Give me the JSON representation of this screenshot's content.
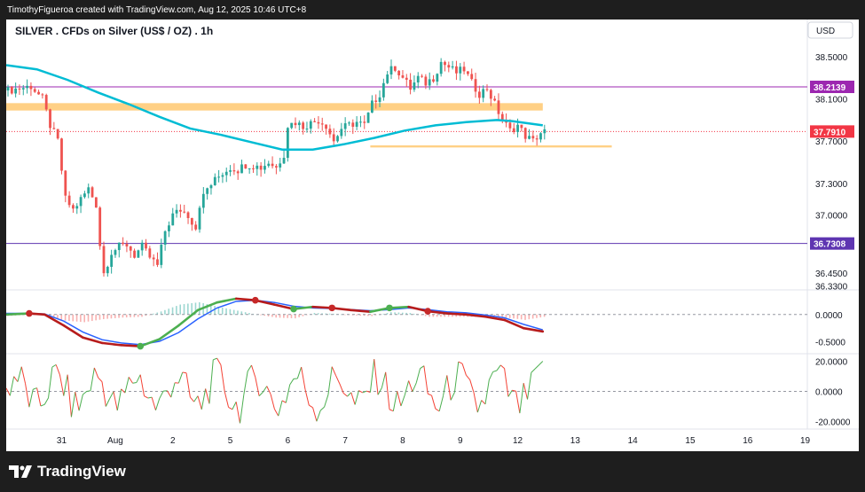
{
  "header": {
    "attribution": "TimothyFigueroa created with TradingView.com, Aug 12, 2025 10:46 UTC+8"
  },
  "footer": {
    "brand": "TradingView"
  },
  "chart_data": {
    "type": "candlestick",
    "title": "SILVER . CFDs on Silver (US$ / OZ) . 1h",
    "currency_label": "USD",
    "ylim": [
      36.3,
      38.6
    ],
    "price_ticks": [
      "38.5000",
      "38.1000",
      "37.7000",
      "37.3000",
      "37.0000",
      "36.4500",
      "36.3300"
    ],
    "horizontal_lines": [
      {
        "label": "38.2139",
        "value": 38.2139,
        "color": "#9c27b0"
      },
      {
        "label": "36.7308",
        "value": 36.7308,
        "color": "#5e35b1"
      }
    ],
    "last_price": {
      "label": "37.7910",
      "value": 37.791,
      "color": "#f23645"
    },
    "zones": [
      {
        "from_index": 0,
        "to_index": 140,
        "low": 37.99,
        "high": 38.06,
        "color": "#ffc870"
      },
      {
        "from_index": 95,
        "to_index": 158,
        "low": 37.64,
        "high": 37.66,
        "color": "#ffc870"
      }
    ],
    "x_ticks": [
      {
        "label": "31",
        "index": 14
      },
      {
        "label": "Aug",
        "index": 28
      },
      {
        "label": "2",
        "index": 43
      },
      {
        "label": "5",
        "index": 58
      },
      {
        "label": "6",
        "index": 73
      },
      {
        "label": "7",
        "index": 88
      },
      {
        "label": "8",
        "index": 103
      },
      {
        "label": "9",
        "index": 118
      },
      {
        "label": "12",
        "index": 133
      },
      {
        "label": "13",
        "index": 148
      },
      {
        "label": "14",
        "index": 163
      },
      {
        "label": "15",
        "index": 178
      },
      {
        "label": "16",
        "index": 193
      },
      {
        "label": "19",
        "index": 208
      }
    ],
    "close_path": [
      [
        0,
        38.18
      ],
      [
        3,
        38.2
      ],
      [
        6,
        38.22
      ],
      [
        9,
        38.1
      ],
      [
        11,
        37.85
      ],
      [
        13,
        37.7
      ],
      [
        15,
        37.15
      ],
      [
        17,
        37.05
      ],
      [
        19,
        37.15
      ],
      [
        21,
        37.25
      ],
      [
        23,
        37.1
      ],
      [
        24,
        36.72
      ],
      [
        25,
        36.45
      ],
      [
        27,
        36.65
      ],
      [
        29,
        36.7
      ],
      [
        31,
        36.72
      ],
      [
        33,
        36.62
      ],
      [
        35,
        36.7
      ],
      [
        37,
        36.6
      ],
      [
        39,
        36.52
      ],
      [
        41,
        36.85
      ],
      [
        43,
        37.0
      ],
      [
        45,
        37.05
      ],
      [
        47,
        37.0
      ],
      [
        49,
        36.88
      ],
      [
        50,
        37.1
      ],
      [
        52,
        37.25
      ],
      [
        54,
        37.33
      ],
      [
        56,
        37.4
      ],
      [
        58,
        37.45
      ],
      [
        60,
        37.43
      ],
      [
        62,
        37.48
      ],
      [
        64,
        37.47
      ],
      [
        66,
        37.45
      ],
      [
        68,
        37.5
      ],
      [
        70,
        37.45
      ],
      [
        72,
        37.58
      ],
      [
        73,
        37.85
      ],
      [
        75,
        37.88
      ],
      [
        77,
        37.84
      ],
      [
        79,
        37.87
      ],
      [
        81,
        37.9
      ],
      [
        83,
        37.85
      ],
      [
        85,
        37.7
      ],
      [
        87,
        37.82
      ],
      [
        89,
        37.85
      ],
      [
        91,
        37.88
      ],
      [
        93,
        37.85
      ],
      [
        95,
        38.05
      ],
      [
        97,
        38.15
      ],
      [
        99,
        38.35
      ],
      [
        101,
        38.4
      ],
      [
        103,
        38.3
      ],
      [
        105,
        38.2
      ],
      [
        107,
        38.3
      ],
      [
        109,
        38.25
      ],
      [
        111,
        38.3
      ],
      [
        113,
        38.45
      ],
      [
        115,
        38.4
      ],
      [
        117,
        38.35
      ],
      [
        119,
        38.38
      ],
      [
        121,
        38.25
      ],
      [
        123,
        38.15
      ],
      [
        125,
        38.2
      ],
      [
        127,
        38.05
      ],
      [
        129,
        37.9
      ],
      [
        131,
        37.8
      ],
      [
        133,
        37.85
      ],
      [
        135,
        37.75
      ],
      [
        137,
        37.7
      ],
      [
        139,
        37.78
      ],
      [
        140,
        37.79
      ]
    ],
    "ma_path": [
      [
        0,
        38.42
      ],
      [
        8,
        38.38
      ],
      [
        16,
        38.28
      ],
      [
        24,
        38.16
      ],
      [
        32,
        38.05
      ],
      [
        40,
        37.93
      ],
      [
        48,
        37.82
      ],
      [
        56,
        37.76
      ],
      [
        64,
        37.69
      ],
      [
        72,
        37.62
      ],
      [
        80,
        37.62
      ],
      [
        88,
        37.67
      ],
      [
        96,
        37.73
      ],
      [
        104,
        37.8
      ],
      [
        112,
        37.85
      ],
      [
        120,
        37.88
      ],
      [
        128,
        37.9
      ],
      [
        132,
        37.89
      ],
      [
        136,
        37.87
      ],
      [
        140,
        37.85
      ]
    ],
    "macd_panel": {
      "ylim": [
        -0.7,
        0.45
      ],
      "ticks": [
        "0.0000",
        "-0.5000"
      ],
      "zero": 0,
      "macd": [
        [
          0,
          0.0
        ],
        [
          6,
          0.02
        ],
        [
          10,
          0.0
        ],
        [
          15,
          -0.2
        ],
        [
          20,
          -0.42
        ],
        [
          25,
          -0.52
        ],
        [
          30,
          -0.56
        ],
        [
          35,
          -0.58
        ],
        [
          40,
          -0.45
        ],
        [
          45,
          -0.2
        ],
        [
          50,
          0.08
        ],
        [
          55,
          0.22
        ],
        [
          60,
          0.29
        ],
        [
          65,
          0.26
        ],
        [
          70,
          0.18
        ],
        [
          75,
          0.1
        ],
        [
          80,
          0.14
        ],
        [
          85,
          0.12
        ],
        [
          90,
          0.08
        ],
        [
          95,
          0.05
        ],
        [
          100,
          0.12
        ],
        [
          105,
          0.14
        ],
        [
          110,
          0.06
        ],
        [
          115,
          0.02
        ],
        [
          120,
          0.0
        ],
        [
          125,
          -0.04
        ],
        [
          130,
          -0.1
        ],
        [
          135,
          -0.25
        ],
        [
          140,
          -0.31
        ]
      ],
      "signal": [
        [
          0,
          0.02
        ],
        [
          6,
          0.02
        ],
        [
          10,
          0.01
        ],
        [
          15,
          -0.12
        ],
        [
          20,
          -0.32
        ],
        [
          25,
          -0.46
        ],
        [
          30,
          -0.52
        ],
        [
          35,
          -0.55
        ],
        [
          40,
          -0.49
        ],
        [
          45,
          -0.33
        ],
        [
          50,
          -0.08
        ],
        [
          55,
          0.12
        ],
        [
          60,
          0.24
        ],
        [
          65,
          0.26
        ],
        [
          70,
          0.22
        ],
        [
          75,
          0.15
        ],
        [
          80,
          0.12
        ],
        [
          85,
          0.11
        ],
        [
          90,
          0.09
        ],
        [
          95,
          0.07
        ],
        [
          100,
          0.09
        ],
        [
          105,
          0.12
        ],
        [
          110,
          0.09
        ],
        [
          115,
          0.05
        ],
        [
          120,
          0.03
        ],
        [
          125,
          -0.01
        ],
        [
          130,
          -0.06
        ],
        [
          135,
          -0.18
        ],
        [
          140,
          -0.28
        ]
      ],
      "cross_up": [
        [
          35,
          -0.58
        ],
        [
          75,
          0.1
        ],
        [
          100,
          0.12
        ]
      ],
      "cross_down": [
        [
          6,
          0.02
        ],
        [
          65,
          0.26
        ],
        [
          85,
          0.12
        ],
        [
          110,
          0.06
        ]
      ]
    },
    "osc_panel": {
      "ylim": [
        -25,
        25
      ],
      "ticks": [
        "20.0000",
        "0.0000",
        "-20.0000"
      ],
      "zero": 0
    }
  }
}
